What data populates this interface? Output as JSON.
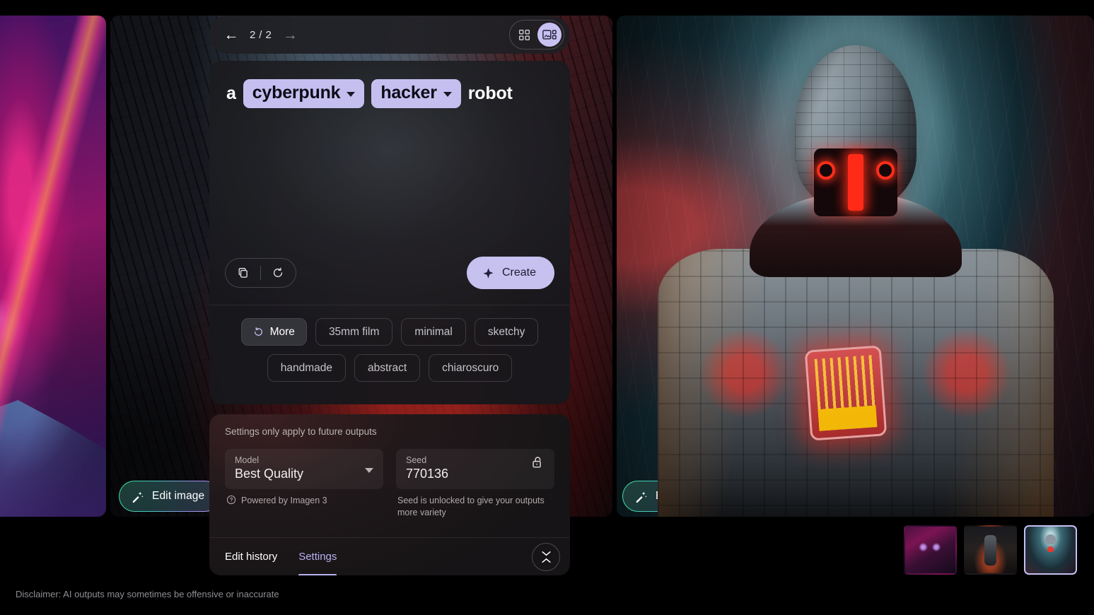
{
  "topbar": {
    "prev_icon": "arrow-left-icon",
    "next_icon": "arrow-right-icon",
    "page_count": "2 / 2",
    "grid_view_icon": "grid-view-icon",
    "detail_view_icon": "detail-view-icon",
    "selected_view": "detail"
  },
  "prompt": {
    "parts": [
      {
        "type": "text",
        "text": "a"
      },
      {
        "type": "chip",
        "text": "cyberpunk"
      },
      {
        "type": "chip",
        "text": "hacker"
      },
      {
        "type": "text",
        "text": "robot"
      }
    ],
    "copy_icon": "copy-icon",
    "refresh_icon": "refresh-icon",
    "create_label": "Create",
    "create_icon": "sparkle-icon"
  },
  "styles": {
    "more_label": "More",
    "more_icon": "refresh-icon",
    "row1": [
      "35mm film",
      "minimal",
      "sketchy"
    ],
    "row2": [
      "handmade",
      "abstract",
      "chiaroscuro"
    ]
  },
  "settings": {
    "note": "Settings only apply to future outputs",
    "model": {
      "label": "Model",
      "value": "Best Quality",
      "help": "Powered by Imagen 3",
      "help_icon": "help-circle-icon",
      "caret_icon": "chevron-down-icon"
    },
    "seed": {
      "label": "Seed",
      "value": "770136",
      "help": "Seed is unlocked to give your outputs more variety",
      "lock_icon": "unlock-icon"
    },
    "tabs": [
      {
        "label": "Edit history",
        "active": false
      },
      {
        "label": "Settings",
        "active": true
      }
    ],
    "collapse_icon": "collapse-icon"
  },
  "images": {
    "edit_button_label": "Edit image",
    "edit_button_icon": "magic-wand-icon",
    "left_alt": "neon magenta cyberpunk alley with robot",
    "mid_alt": "dark brick alley with red neon light",
    "right_alt": "cyberpunk hacker robot holding glowing tablet"
  },
  "thumbnails": [
    {
      "name": "thumbnail-1",
      "selected": false
    },
    {
      "name": "thumbnail-2",
      "selected": false
    },
    {
      "name": "thumbnail-3",
      "selected": true
    }
  ],
  "footer": {
    "disclaimer": "Disclaimer: AI outputs may sometimes be offensive or inaccurate"
  },
  "colors": {
    "accent_lavender": "#c5bff0",
    "accent_lavender_text": "#b9b1f0",
    "panel_dark": "#1a1a1e",
    "edit_border_start": "#3ddc9a",
    "edit_border_end": "#c39bf0"
  }
}
